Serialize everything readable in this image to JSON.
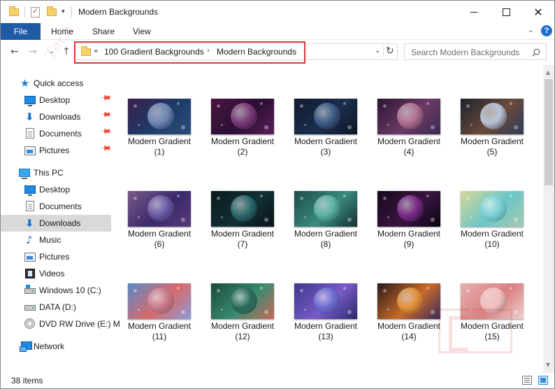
{
  "window": {
    "title": "Modern Backgrounds",
    "controls": {
      "minimize": "minimize",
      "maximize": "maximize",
      "close": "✕"
    }
  },
  "ribbon": {
    "tabs": [
      {
        "label": "File"
      },
      {
        "label": "Home"
      },
      {
        "label": "Share"
      },
      {
        "label": "View"
      }
    ],
    "expand_icon": "chevron-down-icon",
    "help": "?"
  },
  "navigation": {
    "back": "←",
    "forward": "→",
    "recent": "⌄",
    "up": "↑",
    "overflow": "«",
    "breadcrumbs": [
      {
        "label": "100 Gradient Backgrounds"
      },
      {
        "label": "Modern Backgrounds"
      }
    ],
    "crumb_separator": "›",
    "dropdown": "⌄",
    "refresh": "↻",
    "search_placeholder": "Search Modern Backgrounds",
    "highlight_color": "#e2353b"
  },
  "sidebar": {
    "quick_access": {
      "label": "Quick access",
      "items": [
        {
          "label": "Desktop",
          "icon": "desktop-icon",
          "pinned": true
        },
        {
          "label": "Downloads",
          "icon": "download-icon",
          "pinned": true
        },
        {
          "label": "Documents",
          "icon": "document-icon",
          "pinned": true
        },
        {
          "label": "Pictures",
          "icon": "pictures-icon",
          "pinned": true
        }
      ]
    },
    "this_pc": {
      "label": "This PC",
      "items": [
        {
          "label": "Desktop",
          "icon": "desktop-icon"
        },
        {
          "label": "Documents",
          "icon": "document-icon"
        },
        {
          "label": "Downloads",
          "icon": "download-icon",
          "selected": true
        },
        {
          "label": "Music",
          "icon": "music-icon"
        },
        {
          "label": "Pictures",
          "icon": "pictures-icon"
        },
        {
          "label": "Videos",
          "icon": "videos-icon"
        },
        {
          "label": "Windows 10 (C:)",
          "icon": "windows-drive-icon"
        },
        {
          "label": "DATA (D:)",
          "icon": "drive-icon"
        },
        {
          "label": "DVD RW Drive (E:) M",
          "icon": "dvd-drive-icon"
        }
      ]
    },
    "network": {
      "label": "Network",
      "icon": "network-icon"
    }
  },
  "files": [
    {
      "name": "Modern Gradient",
      "num": "(1)",
      "bg": [
        "#3a1f4a",
        "#1d3c68",
        "#2a4f7a"
      ],
      "sphere": "#6f86b8"
    },
    {
      "name": "Modern Gradient",
      "num": "(2)",
      "bg": [
        "#4a1540",
        "#2a0f34",
        "#5d1f58"
      ],
      "sphere": "#7a3a78"
    },
    {
      "name": "Modern Gradient",
      "num": "(3)",
      "bg": [
        "#0f1a2e",
        "#1b2f4e",
        "#0b1424"
      ],
      "sphere": "#3c5a86"
    },
    {
      "name": "Modern Gradient",
      "num": "(4)",
      "bg": [
        "#2b1530",
        "#6b3a66",
        "#3a2a52"
      ],
      "sphere": "#b07090"
    },
    {
      "name": "Modern Gradient",
      "num": "(5)",
      "bg": [
        "#1a2230",
        "#6b4a3a",
        "#2c3c5a"
      ],
      "sphere": "#b8c2d6"
    },
    {
      "name": "Modern Gradient",
      "num": "(6)",
      "bg": [
        "#7a5a8a",
        "#3a2a6a",
        "#5a3a7a"
      ],
      "sphere": "#6a5aa8"
    },
    {
      "name": "Modern Gradient",
      "num": "(7)",
      "bg": [
        "#0b1a1c",
        "#123036",
        "#0a1416"
      ],
      "sphere": "#2a6a6e"
    },
    {
      "name": "Modern Gradient",
      "num": "(8)",
      "bg": [
        "#1f4a4a",
        "#3a8a80",
        "#15302e"
      ],
      "sphere": "#5ab0a4"
    },
    {
      "name": "Modern Gradient",
      "num": "(9)",
      "bg": [
        "#150a1a",
        "#3a1540",
        "#0a0612"
      ],
      "sphere": "#7a2a8a"
    },
    {
      "name": "Modern Gradient",
      "num": "(10)",
      "bg": [
        "#d8d89a",
        "#6ac6c8",
        "#a8c8b0"
      ],
      "sphere": "#7ad2d6"
    },
    {
      "name": "Modern Gradient",
      "num": "(11)",
      "bg": [
        "#5a8ac8",
        "#d86a6a",
        "#8a9ad8"
      ],
      "sphere": "#c87a8a"
    },
    {
      "name": "Modern Gradient",
      "num": "(12)",
      "bg": [
        "#1a4a3a",
        "#3a8a70",
        "#c86a5a"
      ],
      "sphere": "#2a6a5a"
    },
    {
      "name": "Modern Gradient",
      "num": "(13)",
      "bg": [
        "#3a3a8a",
        "#7a5ac8",
        "#2a2a6a"
      ],
      "sphere": "#6a6ad0"
    },
    {
      "name": "Modern Gradient",
      "num": "(14)",
      "bg": [
        "#2a1a1a",
        "#c86a2a",
        "#3a2a5a"
      ],
      "sphere": "#e0903a"
    },
    {
      "name": "Modern Gradient",
      "num": "(15)",
      "bg": [
        "#e8b0b0",
        "#d88080",
        "#f0d0d0"
      ],
      "sphere": "#f0c0c0"
    }
  ],
  "status": {
    "count_text": "38 items",
    "views": [
      "details-view-icon",
      "large-icons-view-icon"
    ]
  }
}
